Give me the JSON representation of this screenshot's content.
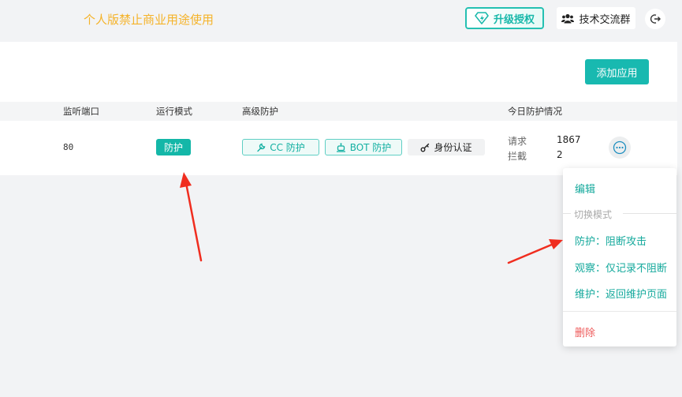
{
  "header": {
    "notice": "个人版禁止商业用途使用",
    "upgrade_label": "升级授权",
    "community_label": "技术交流群",
    "upgrade_icon": "diamond-bolt-icon",
    "community_icon": "users-icon",
    "logout_icon": "logout-icon"
  },
  "toolbar": {
    "add_app_label": "添加应用"
  },
  "table": {
    "columns": {
      "port": "监听端口",
      "mode": "运行模式",
      "advanced": "高级防护",
      "today": "今日防护情况"
    },
    "row": {
      "port": "80",
      "mode": "防护",
      "cc_tag": "CC 防护",
      "bot_tag": "BOT 防护",
      "auth_tag": "身份认证",
      "stats": {
        "request_label": "请求",
        "request_value": "1867",
        "block_label": "拦截",
        "block_value": "2"
      }
    }
  },
  "dropdown": {
    "edit": "编辑",
    "switch_mode": "切换模式",
    "protect": "防护：阻断攻击",
    "observe": "观察：仅记录不阻断",
    "maintain": "维护：返回维护页面",
    "delete": "删除"
  },
  "colors": {
    "accent": "#18b9b0",
    "notice": "#f5b32a",
    "danger": "#ee5a5a",
    "arrow": "#f02d1f"
  }
}
